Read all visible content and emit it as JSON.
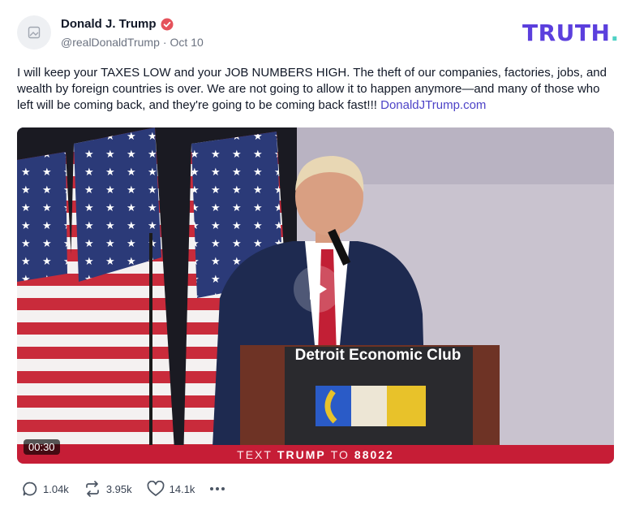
{
  "post": {
    "display_name": "Donald J. Trump",
    "handle": "@realDonaldTrump",
    "separator": "·",
    "date": "Oct 10",
    "text": "I will keep your TAXES LOW and your JOB NUMBERS HIGH. The theft of our companies, factories, jobs, and wealth by foreign countries is over. We are not going to allow it to happen anymore—and many of those who left will be coming back, and they're going to be coming back fast!!!",
    "link_text": "DonaldJTrump.com"
  },
  "brand": {
    "logo_text": "TRUTH",
    "logo_dot": "."
  },
  "video": {
    "duration": "00:30",
    "podium_text": "Detroit Economic Club",
    "banner_prefix": "TEXT",
    "banner_name": "TRUMP",
    "banner_mid": "TO",
    "banner_number": "88022"
  },
  "actions": {
    "replies": "1.04k",
    "retruths": "3.95k",
    "likes": "14.1k"
  },
  "colors": {
    "brand_purple": "#5b3fdd",
    "link": "#4d43c7",
    "banner_red": "#c61d36",
    "verified": "#e5525b"
  }
}
